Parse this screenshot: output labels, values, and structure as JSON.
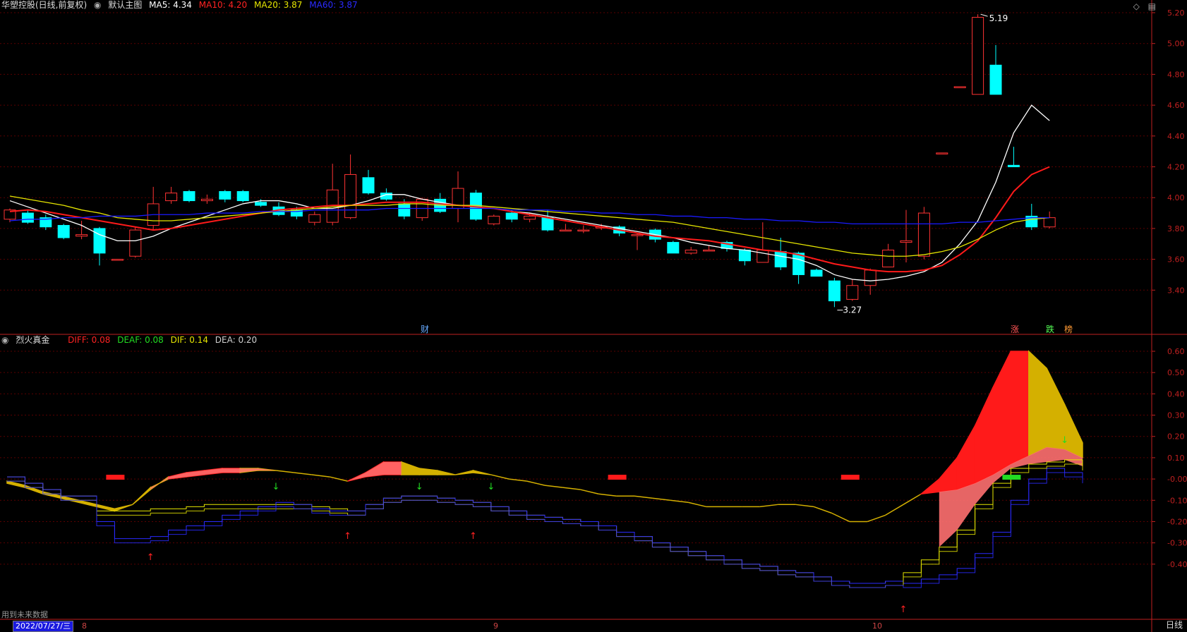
{
  "header_main": {
    "stock": "华塑控股(日线,前复权)",
    "view": "默认主图",
    "ma5": "MA5: 4.34",
    "ma10": "MA10: 4.20",
    "ma20": "MA20: 3.87",
    "ma60": "MA60: 3.87"
  },
  "header_sub": {
    "indicator": "烈火真金",
    "diff": "DIFF: 0.08",
    "deaf": "DEAF: 0.08",
    "dif": "DIF: 0.14",
    "dea": "DEA: 0.20"
  },
  "colors": {
    "ma5": "#ffffff",
    "ma10": "#ff1a1a",
    "ma20": "#e6e600",
    "ma60": "#1a1aff",
    "up": "#ff3333",
    "down": "#00ffff",
    "axis": "#c02020"
  },
  "footer": {
    "note": "用到未来数据",
    "cursor_date": "2022/07/27/三",
    "period": "日线"
  },
  "x_labels": [
    "8",
    "9",
    "10"
  ],
  "markers": {
    "cai": "财",
    "zhang": "涨",
    "die": "跌",
    "bang": "榜"
  },
  "annotations": {
    "high": "5.19",
    "low": "3.27"
  },
  "chart_data": [
    {
      "type": "candlestick",
      "title": "华塑控股(日线,前复权)",
      "y_ticks": [
        "5.20",
        "5.00",
        "4.80",
        "4.60",
        "4.40",
        "4.20",
        "4.00",
        "3.80",
        "3.60",
        "3.40"
      ],
      "ylim": [
        3.2,
        5.25
      ],
      "candles": [
        [
          3.86,
          3.92,
          3.84,
          3.93
        ],
        [
          3.9,
          3.84,
          3.83,
          3.92
        ],
        [
          3.87,
          3.81,
          3.79,
          3.89
        ],
        [
          3.82,
          3.74,
          3.73,
          3.83
        ],
        [
          3.75,
          3.76,
          3.73,
          3.85
        ],
        [
          3.8,
          3.64,
          3.56,
          3.81
        ],
        [
          3.6,
          3.6,
          3.6,
          3.6
        ],
        [
          3.62,
          3.79,
          3.61,
          3.81
        ],
        [
          3.82,
          3.96,
          3.79,
          4.07
        ],
        [
          3.98,
          4.03,
          3.96,
          4.07
        ],
        [
          4.04,
          3.98,
          3.97,
          4.05
        ],
        [
          3.98,
          3.99,
          3.96,
          4.02
        ],
        [
          4.04,
          3.99,
          3.97,
          4.05
        ],
        [
          4.04,
          3.98,
          3.97,
          4.05
        ],
        [
          3.97,
          3.95,
          3.94,
          3.99
        ],
        [
          3.94,
          3.89,
          3.88,
          3.97
        ],
        [
          3.92,
          3.88,
          3.86,
          3.94
        ],
        [
          3.84,
          3.89,
          3.82,
          3.91
        ],
        [
          3.84,
          4.05,
          3.82,
          4.22
        ],
        [
          3.87,
          4.15,
          3.86,
          4.28
        ],
        [
          4.13,
          4.03,
          4.02,
          4.18
        ],
        [
          4.03,
          3.99,
          3.98,
          4.06
        ],
        [
          3.96,
          3.88,
          3.86,
          3.99
        ],
        [
          3.87,
          3.99,
          3.85,
          4.0
        ],
        [
          3.99,
          3.91,
          3.9,
          4.03
        ],
        [
          3.93,
          4.06,
          3.84,
          4.17
        ],
        [
          4.03,
          3.86,
          3.85,
          4.05
        ],
        [
          3.83,
          3.88,
          3.82,
          3.89
        ],
        [
          3.9,
          3.86,
          3.84,
          3.92
        ],
        [
          3.86,
          3.88,
          3.84,
          3.9
        ],
        [
          3.87,
          3.79,
          3.78,
          3.92
        ],
        [
          3.79,
          3.79,
          3.79,
          3.83
        ],
        [
          3.79,
          3.79,
          3.77,
          3.82
        ],
        [
          3.81,
          3.81,
          3.79,
          3.83
        ],
        [
          3.81,
          3.77,
          3.75,
          3.82
        ],
        [
          3.76,
          3.76,
          3.66,
          3.77
        ],
        [
          3.79,
          3.73,
          3.71,
          3.8
        ],
        [
          3.71,
          3.64,
          3.64,
          3.72
        ],
        [
          3.64,
          3.66,
          3.63,
          3.68
        ],
        [
          3.66,
          3.66,
          3.66,
          3.69
        ],
        [
          3.71,
          3.67,
          3.65,
          3.72
        ],
        [
          3.66,
          3.59,
          3.56,
          3.67
        ],
        [
          3.58,
          3.66,
          3.58,
          3.84
        ],
        [
          3.65,
          3.55,
          3.53,
          3.74
        ],
        [
          3.64,
          3.5,
          3.44,
          3.65
        ],
        [
          3.53,
          3.49,
          3.49,
          3.54
        ],
        [
          3.46,
          3.33,
          3.29,
          3.48
        ],
        [
          3.34,
          3.43,
          3.33,
          3.47
        ],
        [
          3.43,
          3.53,
          3.37,
          3.54
        ],
        [
          3.55,
          3.66,
          3.55,
          3.7
        ],
        [
          3.71,
          3.72,
          3.58,
          3.92
        ],
        [
          3.62,
          3.9,
          3.6,
          3.94
        ],
        [
          4.29,
          4.29,
          4.29,
          4.29
        ],
        [
          4.72,
          4.72,
          4.72,
          4.72
        ],
        [
          4.67,
          5.17,
          4.67,
          5.19
        ],
        [
          4.86,
          4.67,
          4.67,
          4.99
        ],
        [
          4.21,
          4.2,
          4.2,
          4.33
        ],
        [
          3.88,
          3.81,
          3.79,
          3.96
        ],
        [
          3.81,
          3.87,
          3.8,
          3.91
        ]
      ],
      "series": [
        {
          "name": "MA5",
          "values": [
            3.98,
            3.94,
            3.9,
            3.86,
            3.82,
            3.76,
            3.72,
            3.72,
            3.75,
            3.8,
            3.84,
            3.88,
            3.92,
            3.96,
            3.98,
            3.98,
            3.96,
            3.93,
            3.93,
            3.95,
            3.98,
            4.02,
            4.02,
            3.99,
            3.97,
            3.95,
            3.94,
            3.93,
            3.91,
            3.9,
            3.88,
            3.86,
            3.84,
            3.82,
            3.8,
            3.78,
            3.76,
            3.74,
            3.71,
            3.69,
            3.67,
            3.66,
            3.64,
            3.62,
            3.6,
            3.56,
            3.5,
            3.47,
            3.46,
            3.47,
            3.49,
            3.52,
            3.58,
            3.7,
            3.85,
            4.1,
            4.42,
            4.6,
            4.5
          ]
        },
        {
          "name": "MA10",
          "values": [
            3.91,
            3.92,
            3.91,
            3.89,
            3.87,
            3.85,
            3.83,
            3.81,
            3.79,
            3.8,
            3.82,
            3.84,
            3.86,
            3.88,
            3.9,
            3.92,
            3.93,
            3.94,
            3.95,
            3.95,
            3.96,
            3.97,
            3.97,
            3.97,
            3.96,
            3.95,
            3.94,
            3.93,
            3.91,
            3.89,
            3.87,
            3.85,
            3.83,
            3.81,
            3.79,
            3.77,
            3.75,
            3.74,
            3.73,
            3.72,
            3.7,
            3.68,
            3.66,
            3.65,
            3.63,
            3.6,
            3.57,
            3.55,
            3.53,
            3.52,
            3.52,
            3.53,
            3.56,
            3.63,
            3.72,
            3.87,
            4.04,
            4.15,
            4.2
          ]
        },
        {
          "name": "MA20",
          "values": [
            4.01,
            3.99,
            3.97,
            3.95,
            3.92,
            3.9,
            3.87,
            3.86,
            3.85,
            3.85,
            3.86,
            3.87,
            3.88,
            3.89,
            3.9,
            3.91,
            3.92,
            3.93,
            3.94,
            3.95,
            3.95,
            3.95,
            3.96,
            3.96,
            3.95,
            3.95,
            3.95,
            3.94,
            3.93,
            3.92,
            3.91,
            3.9,
            3.89,
            3.88,
            3.87,
            3.86,
            3.85,
            3.84,
            3.82,
            3.8,
            3.78,
            3.76,
            3.74,
            3.72,
            3.7,
            3.68,
            3.66,
            3.64,
            3.63,
            3.62,
            3.62,
            3.63,
            3.65,
            3.68,
            3.73,
            3.79,
            3.84,
            3.86,
            3.87
          ]
        },
        {
          "name": "MA60",
          "values": [
            3.85,
            3.86,
            3.86,
            3.87,
            3.87,
            3.88,
            3.88,
            3.88,
            3.89,
            3.89,
            3.89,
            3.9,
            3.9,
            3.9,
            3.91,
            3.91,
            3.91,
            3.92,
            3.92,
            3.92,
            3.92,
            3.93,
            3.93,
            3.93,
            3.93,
            3.93,
            3.93,
            3.93,
            3.92,
            3.92,
            3.92,
            3.91,
            3.91,
            3.9,
            3.9,
            3.89,
            3.89,
            3.88,
            3.88,
            3.87,
            3.87,
            3.86,
            3.86,
            3.85,
            3.85,
            3.84,
            3.84,
            3.83,
            3.83,
            3.83,
            3.83,
            3.83,
            3.83,
            3.84,
            3.84,
            3.85,
            3.86,
            3.87,
            3.87
          ]
        }
      ]
    },
    {
      "type": "line",
      "title": "烈火真金",
      "y_ticks": [
        "0.60",
        "0.50",
        "0.40",
        "0.30",
        "0.20",
        "0.10",
        "-0.00",
        "-0.10",
        "-0.20",
        "-0.30",
        "-0.40"
      ],
      "ylim": [
        -0.52,
        0.68
      ],
      "series": [
        {
          "name": "DIFF",
          "values": [
            -0.02,
            -0.04,
            -0.07,
            -0.09,
            -0.11,
            -0.13,
            -0.15,
            -0.12,
            -0.05,
            0.01,
            0.03,
            0.04,
            0.05,
            0.05,
            0.05,
            0.04,
            0.03,
            0.02,
            0.01,
            -0.01,
            0.03,
            0.08,
            0.08,
            0.05,
            0.04,
            0.02,
            0.04,
            0.02,
            0.0,
            -0.01,
            -0.03,
            -0.04,
            -0.05,
            -0.07,
            -0.08,
            -0.08,
            -0.09,
            -0.1,
            -0.11,
            -0.13,
            -0.13,
            -0.13,
            -0.13,
            -0.12,
            -0.12,
            -0.13,
            -0.16,
            -0.2,
            -0.2,
            -0.17,
            -0.12,
            -0.07,
            0.0,
            0.1,
            0.25,
            0.43,
            0.6,
            0.6,
            0.52,
            0.35,
            0.17
          ]
        },
        {
          "name": "DEAF",
          "values": [
            -0.01,
            -0.03,
            -0.06,
            -0.08,
            -0.1,
            -0.12,
            -0.14,
            -0.12,
            -0.04,
            0.0,
            0.01,
            0.02,
            0.03,
            0.03,
            0.04,
            0.04,
            0.03,
            0.02,
            0.01,
            -0.01,
            0.01,
            0.02,
            0.02,
            0.02,
            0.02,
            0.02,
            0.03,
            0.02,
            0.0,
            -0.01,
            -0.03,
            -0.04,
            -0.05,
            -0.07,
            -0.08,
            -0.08,
            -0.09,
            -0.1,
            -0.11,
            -0.13,
            -0.13,
            -0.13,
            -0.13,
            -0.12,
            -0.12,
            -0.13,
            -0.16,
            -0.2,
            -0.2,
            -0.17,
            -0.12,
            -0.07,
            -0.06,
            -0.05,
            -0.02,
            0.02,
            0.07,
            0.11,
            0.15,
            0.14,
            0.1
          ]
        },
        {
          "name": "DIF",
          "values": [
            0.01,
            -0.02,
            -0.05,
            -0.08,
            -0.08,
            -0.15,
            -0.15,
            -0.15,
            -0.14,
            -0.14,
            -0.13,
            -0.12,
            -0.12,
            -0.12,
            -0.12,
            -0.12,
            -0.12,
            -0.13,
            -0.14,
            -0.15,
            -0.12,
            -0.09,
            -0.08,
            -0.08,
            -0.09,
            -0.1,
            -0.11,
            -0.13,
            -0.15,
            -0.17,
            -0.18,
            -0.19,
            -0.2,
            -0.22,
            -0.25,
            -0.27,
            -0.3,
            -0.32,
            -0.34,
            -0.36,
            -0.38,
            -0.4,
            -0.41,
            -0.43,
            -0.44,
            -0.46,
            -0.48,
            -0.49,
            -0.49,
            -0.48,
            -0.44,
            -0.38,
            -0.32,
            -0.24,
            -0.12,
            -0.02,
            0.05,
            0.07,
            0.08,
            0.09,
            0.06
          ]
        },
        {
          "name": "DEA",
          "values": [
            0.01,
            -0.02,
            -0.05,
            -0.08,
            -0.08,
            -0.2,
            -0.28,
            -0.28,
            -0.27,
            -0.24,
            -0.22,
            -0.2,
            -0.17,
            -0.15,
            -0.13,
            -0.11,
            -0.12,
            -0.14,
            -0.15,
            -0.15,
            -0.12,
            -0.09,
            -0.08,
            -0.08,
            -0.09,
            -0.1,
            -0.11,
            -0.13,
            -0.15,
            -0.17,
            -0.18,
            -0.19,
            -0.2,
            -0.22,
            -0.25,
            -0.27,
            -0.3,
            -0.32,
            -0.34,
            -0.36,
            -0.38,
            -0.4,
            -0.41,
            -0.43,
            -0.44,
            -0.46,
            -0.48,
            -0.49,
            -0.49,
            -0.48,
            -0.49,
            -0.47,
            -0.45,
            -0.42,
            -0.35,
            -0.25,
            -0.1,
            0.0,
            0.05,
            0.03,
            0.0
          ]
        }
      ],
      "signals": {
        "red_bars": [
          6,
          34,
          47
        ],
        "green_bars": [
          56
        ],
        "up_arrows": [
          8,
          19,
          26,
          50
        ],
        "down_arrows": [
          15,
          23,
          27,
          59
        ]
      }
    }
  ]
}
